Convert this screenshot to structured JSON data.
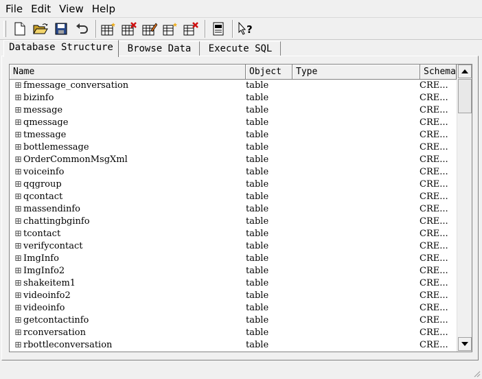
{
  "menu": [
    "File",
    "Edit",
    "View",
    "Help"
  ],
  "toolbar": {
    "buttons": [
      "new-database-icon",
      "open-database-icon",
      "save-icon",
      "undo-icon",
      "create-table-icon",
      "delete-table-icon",
      "modify-table-icon",
      "create-index-icon",
      "delete-index-icon",
      "sql-log-icon",
      "whats-this-help-icon"
    ]
  },
  "tabs": [
    "Database Structure",
    "Browse Data",
    "Execute SQL"
  ],
  "table": {
    "columns": [
      "Name",
      "Object",
      "Type",
      "Schema"
    ],
    "rows": [
      {
        "name": "fmessage_conversation",
        "object": "table",
        "schema": "CRE..."
      },
      {
        "name": "bizinfo",
        "object": "table",
        "schema": "CRE..."
      },
      {
        "name": "message",
        "object": "table",
        "schema": "CRE..."
      },
      {
        "name": "qmessage",
        "object": "table",
        "schema": "CRE..."
      },
      {
        "name": "tmessage",
        "object": "table",
        "schema": "CRE..."
      },
      {
        "name": "bottlemessage",
        "object": "table",
        "schema": "CRE..."
      },
      {
        "name": "OrderCommonMsgXml",
        "object": "table",
        "schema": "CRE..."
      },
      {
        "name": "voiceinfo",
        "object": "table",
        "schema": "CRE..."
      },
      {
        "name": "qqgroup",
        "object": "table",
        "schema": "CRE..."
      },
      {
        "name": "qcontact",
        "object": "table",
        "schema": "CRE..."
      },
      {
        "name": "massendinfo",
        "object": "table",
        "schema": "CRE..."
      },
      {
        "name": "chattingbginfo",
        "object": "table",
        "schema": "CRE..."
      },
      {
        "name": "tcontact",
        "object": "table",
        "schema": "CRE..."
      },
      {
        "name": "verifycontact",
        "object": "table",
        "schema": "CRE..."
      },
      {
        "name": "ImgInfo",
        "object": "table",
        "schema": "CRE..."
      },
      {
        "name": "ImgInfo2",
        "object": "table",
        "schema": "CRE..."
      },
      {
        "name": "shakeitem1",
        "object": "table",
        "schema": "CRE..."
      },
      {
        "name": "videoinfo2",
        "object": "table",
        "schema": "CRE..."
      },
      {
        "name": "videoinfo",
        "object": "table",
        "schema": "CRE..."
      },
      {
        "name": "getcontactinfo",
        "object": "table",
        "schema": "CRE..."
      },
      {
        "name": "rconversation",
        "object": "table",
        "schema": "CRE..."
      },
      {
        "name": "rbottleconversation",
        "object": "table",
        "schema": "CRE..."
      }
    ]
  }
}
